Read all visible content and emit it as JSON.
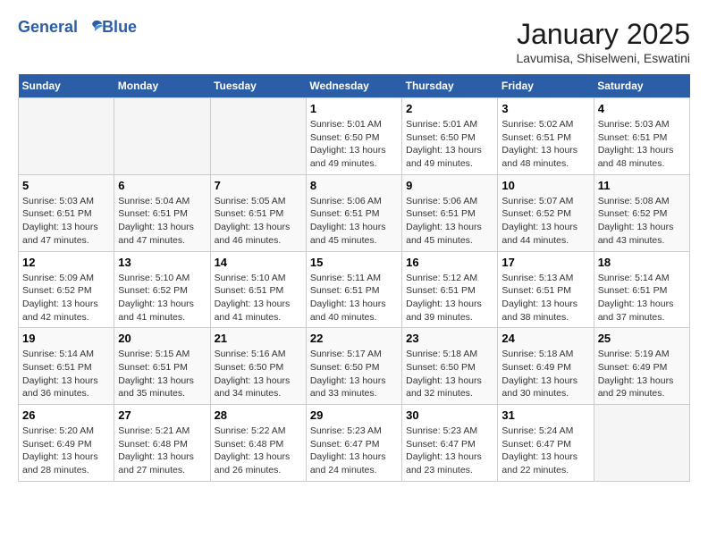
{
  "logo": {
    "line1": "General",
    "line2": "Blue"
  },
  "title": "January 2025",
  "subtitle": "Lavumisa, Shiselweni, Eswatini",
  "weekdays": [
    "Sunday",
    "Monday",
    "Tuesday",
    "Wednesday",
    "Thursday",
    "Friday",
    "Saturday"
  ],
  "weeks": [
    [
      {
        "day": null
      },
      {
        "day": null
      },
      {
        "day": null
      },
      {
        "day": 1,
        "sunrise": "5:01 AM",
        "sunset": "6:50 PM",
        "daylight": "13 hours and 49 minutes."
      },
      {
        "day": 2,
        "sunrise": "5:01 AM",
        "sunset": "6:50 PM",
        "daylight": "13 hours and 49 minutes."
      },
      {
        "day": 3,
        "sunrise": "5:02 AM",
        "sunset": "6:51 PM",
        "daylight": "13 hours and 48 minutes."
      },
      {
        "day": 4,
        "sunrise": "5:03 AM",
        "sunset": "6:51 PM",
        "daylight": "13 hours and 48 minutes."
      }
    ],
    [
      {
        "day": 5,
        "sunrise": "5:03 AM",
        "sunset": "6:51 PM",
        "daylight": "13 hours and 47 minutes."
      },
      {
        "day": 6,
        "sunrise": "5:04 AM",
        "sunset": "6:51 PM",
        "daylight": "13 hours and 47 minutes."
      },
      {
        "day": 7,
        "sunrise": "5:05 AM",
        "sunset": "6:51 PM",
        "daylight": "13 hours and 46 minutes."
      },
      {
        "day": 8,
        "sunrise": "5:06 AM",
        "sunset": "6:51 PM",
        "daylight": "13 hours and 45 minutes."
      },
      {
        "day": 9,
        "sunrise": "5:06 AM",
        "sunset": "6:51 PM",
        "daylight": "13 hours and 45 minutes."
      },
      {
        "day": 10,
        "sunrise": "5:07 AM",
        "sunset": "6:52 PM",
        "daylight": "13 hours and 44 minutes."
      },
      {
        "day": 11,
        "sunrise": "5:08 AM",
        "sunset": "6:52 PM",
        "daylight": "13 hours and 43 minutes."
      }
    ],
    [
      {
        "day": 12,
        "sunrise": "5:09 AM",
        "sunset": "6:52 PM",
        "daylight": "13 hours and 42 minutes."
      },
      {
        "day": 13,
        "sunrise": "5:10 AM",
        "sunset": "6:52 PM",
        "daylight": "13 hours and 41 minutes."
      },
      {
        "day": 14,
        "sunrise": "5:10 AM",
        "sunset": "6:51 PM",
        "daylight": "13 hours and 41 minutes."
      },
      {
        "day": 15,
        "sunrise": "5:11 AM",
        "sunset": "6:51 PM",
        "daylight": "13 hours and 40 minutes."
      },
      {
        "day": 16,
        "sunrise": "5:12 AM",
        "sunset": "6:51 PM",
        "daylight": "13 hours and 39 minutes."
      },
      {
        "day": 17,
        "sunrise": "5:13 AM",
        "sunset": "6:51 PM",
        "daylight": "13 hours and 38 minutes."
      },
      {
        "day": 18,
        "sunrise": "5:14 AM",
        "sunset": "6:51 PM",
        "daylight": "13 hours and 37 minutes."
      }
    ],
    [
      {
        "day": 19,
        "sunrise": "5:14 AM",
        "sunset": "6:51 PM",
        "daylight": "13 hours and 36 minutes."
      },
      {
        "day": 20,
        "sunrise": "5:15 AM",
        "sunset": "6:51 PM",
        "daylight": "13 hours and 35 minutes."
      },
      {
        "day": 21,
        "sunrise": "5:16 AM",
        "sunset": "6:50 PM",
        "daylight": "13 hours and 34 minutes."
      },
      {
        "day": 22,
        "sunrise": "5:17 AM",
        "sunset": "6:50 PM",
        "daylight": "13 hours and 33 minutes."
      },
      {
        "day": 23,
        "sunrise": "5:18 AM",
        "sunset": "6:50 PM",
        "daylight": "13 hours and 32 minutes."
      },
      {
        "day": 24,
        "sunrise": "5:18 AM",
        "sunset": "6:49 PM",
        "daylight": "13 hours and 30 minutes."
      },
      {
        "day": 25,
        "sunrise": "5:19 AM",
        "sunset": "6:49 PM",
        "daylight": "13 hours and 29 minutes."
      }
    ],
    [
      {
        "day": 26,
        "sunrise": "5:20 AM",
        "sunset": "6:49 PM",
        "daylight": "13 hours and 28 minutes."
      },
      {
        "day": 27,
        "sunrise": "5:21 AM",
        "sunset": "6:48 PM",
        "daylight": "13 hours and 27 minutes."
      },
      {
        "day": 28,
        "sunrise": "5:22 AM",
        "sunset": "6:48 PM",
        "daylight": "13 hours and 26 minutes."
      },
      {
        "day": 29,
        "sunrise": "5:23 AM",
        "sunset": "6:47 PM",
        "daylight": "13 hours and 24 minutes."
      },
      {
        "day": 30,
        "sunrise": "5:23 AM",
        "sunset": "6:47 PM",
        "daylight": "13 hours and 23 minutes."
      },
      {
        "day": 31,
        "sunrise": "5:24 AM",
        "sunset": "6:47 PM",
        "daylight": "13 hours and 22 minutes."
      },
      {
        "day": null
      }
    ]
  ],
  "labels": {
    "sunrise_prefix": "Sunrise: ",
    "sunset_prefix": "Sunset: ",
    "daylight_prefix": "Daylight: "
  }
}
